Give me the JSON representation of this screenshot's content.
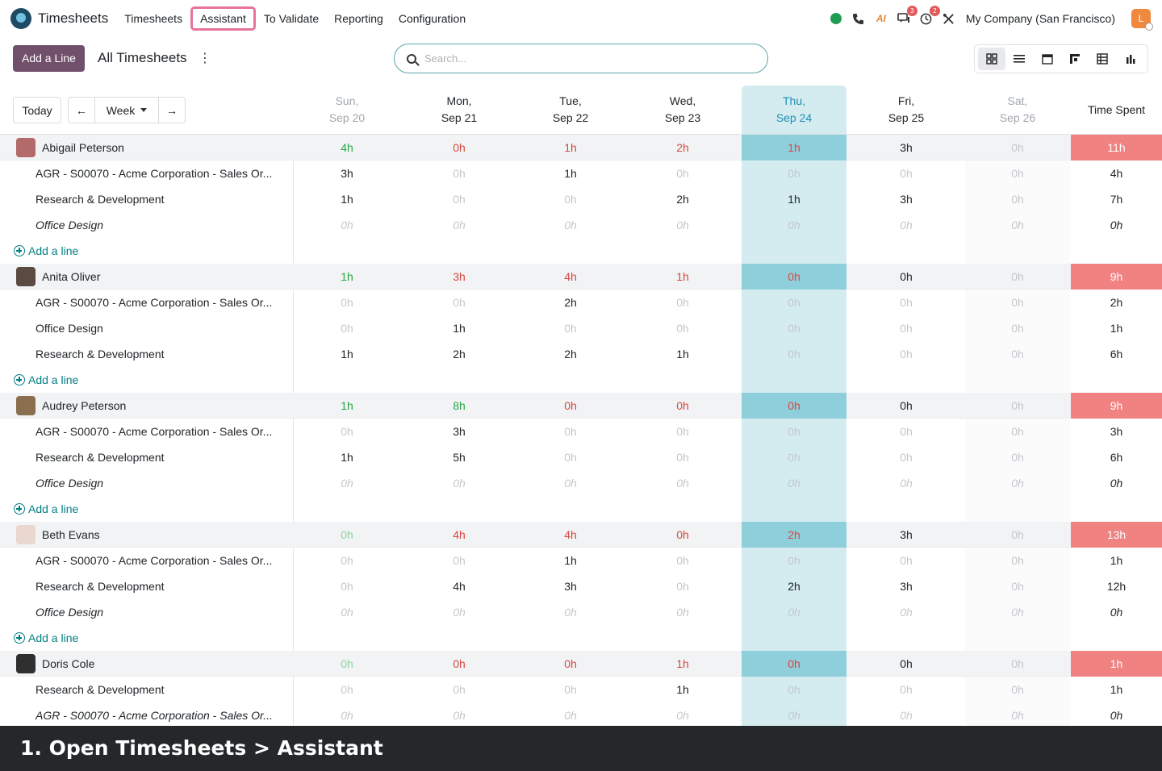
{
  "app": {
    "name": "Timesheets"
  },
  "menu": [
    "Timesheets",
    "Assistant",
    "To Validate",
    "Reporting",
    "Configuration"
  ],
  "systray": {
    "company": "My Company (San Francisco)",
    "messages_badge": "3",
    "activities_badge": "2",
    "user_initial": "L",
    "ai_label": "AI"
  },
  "control_panel": {
    "add_line": "Add a Line",
    "title": "All Timesheets",
    "search_placeholder": "Search..."
  },
  "toolbar": {
    "today": "Today",
    "range": "Week"
  },
  "days": [
    {
      "dow": "Sun,",
      "date": "Sep 20"
    },
    {
      "dow": "Mon,",
      "date": "Sep 21"
    },
    {
      "dow": "Tue,",
      "date": "Sep 22"
    },
    {
      "dow": "Wed,",
      "date": "Sep 23"
    },
    {
      "dow": "Thu,",
      "date": "Sep 24"
    },
    {
      "dow": "Fri,",
      "date": "Sep 25"
    },
    {
      "dow": "Sat,",
      "date": "Sep 26"
    }
  ],
  "total_header": "Time Spent",
  "add_line_label": "Add a line",
  "groups": [
    {
      "name": "Abigail Peterson",
      "avatar_color": "#b36a6a",
      "totals": [
        "4h",
        "0h",
        "1h",
        "2h",
        "1h",
        "3h",
        "0h"
      ],
      "total": "11h",
      "lines": [
        {
          "label": "AGR - S00070 - Acme Corporation - Sales Or...",
          "italic": false,
          "values": [
            "3h",
            "0h",
            "1h",
            "0h",
            "0h",
            "0h",
            "0h"
          ],
          "total": "4h"
        },
        {
          "label": "Research & Development",
          "italic": false,
          "values": [
            "1h",
            "0h",
            "0h",
            "2h",
            "1h",
            "3h",
            "0h"
          ],
          "total": "7h"
        },
        {
          "label": "Office Design",
          "italic": true,
          "values": [
            "0h",
            "0h",
            "0h",
            "0h",
            "0h",
            "0h",
            "0h"
          ],
          "total": "0h"
        }
      ]
    },
    {
      "name": "Anita Oliver",
      "avatar_color": "#5a4a42",
      "totals": [
        "1h",
        "3h",
        "4h",
        "1h",
        "0h",
        "0h",
        "0h"
      ],
      "total": "9h",
      "lines": [
        {
          "label": "AGR - S00070 - Acme Corporation - Sales Or...",
          "italic": false,
          "values": [
            "0h",
            "0h",
            "2h",
            "0h",
            "0h",
            "0h",
            "0h"
          ],
          "total": "2h"
        },
        {
          "label": "Office Design",
          "italic": false,
          "values": [
            "0h",
            "1h",
            "0h",
            "0h",
            "0h",
            "0h",
            "0h"
          ],
          "total": "1h"
        },
        {
          "label": "Research & Development",
          "italic": false,
          "values": [
            "1h",
            "2h",
            "2h",
            "1h",
            "0h",
            "0h",
            "0h"
          ],
          "total": "6h"
        }
      ]
    },
    {
      "name": "Audrey Peterson",
      "avatar_color": "#8a6f4e",
      "totals": [
        "1h",
        "8h",
        "0h",
        "0h",
        "0h",
        "0h",
        "0h"
      ],
      "total": "9h",
      "lines": [
        {
          "label": "AGR - S00070 - Acme Corporation - Sales Or...",
          "italic": false,
          "values": [
            "0h",
            "3h",
            "0h",
            "0h",
            "0h",
            "0h",
            "0h"
          ],
          "total": "3h"
        },
        {
          "label": "Research & Development",
          "italic": false,
          "values": [
            "1h",
            "5h",
            "0h",
            "0h",
            "0h",
            "0h",
            "0h"
          ],
          "total": "6h"
        },
        {
          "label": "Office Design",
          "italic": true,
          "values": [
            "0h",
            "0h",
            "0h",
            "0h",
            "0h",
            "0h",
            "0h"
          ],
          "total": "0h"
        }
      ]
    },
    {
      "name": "Beth Evans",
      "avatar_color": "#e9d7d0",
      "totals": [
        "0h",
        "4h",
        "4h",
        "0h",
        "2h",
        "3h",
        "0h"
      ],
      "total": "13h",
      "lines": [
        {
          "label": "AGR - S00070 - Acme Corporation - Sales Or...",
          "italic": false,
          "values": [
            "0h",
            "0h",
            "1h",
            "0h",
            "0h",
            "0h",
            "0h"
          ],
          "total": "1h"
        },
        {
          "label": "Research & Development",
          "italic": false,
          "values": [
            "0h",
            "4h",
            "3h",
            "0h",
            "2h",
            "3h",
            "0h"
          ],
          "total": "12h"
        },
        {
          "label": "Office Design",
          "italic": true,
          "values": [
            "0h",
            "0h",
            "0h",
            "0h",
            "0h",
            "0h",
            "0h"
          ],
          "total": "0h"
        }
      ]
    },
    {
      "name": "Doris Cole",
      "avatar_color": "#2f2f2f",
      "totals": [
        "0h",
        "0h",
        "0h",
        "1h",
        "0h",
        "0h",
        "0h"
      ],
      "total": "1h",
      "lines": [
        {
          "label": "Research & Development",
          "italic": false,
          "values": [
            "0h",
            "0h",
            "0h",
            "1h",
            "0h",
            "0h",
            "0h"
          ],
          "total": "1h"
        },
        {
          "label": "AGR - S00070 - Acme Corporation - Sales Or...",
          "italic": true,
          "values": [
            "0h",
            "0h",
            "0h",
            "0h",
            "0h",
            "0h",
            "0h"
          ],
          "total": "0h"
        }
      ]
    }
  ],
  "caption": "1. Open Timesheets > Assistant"
}
